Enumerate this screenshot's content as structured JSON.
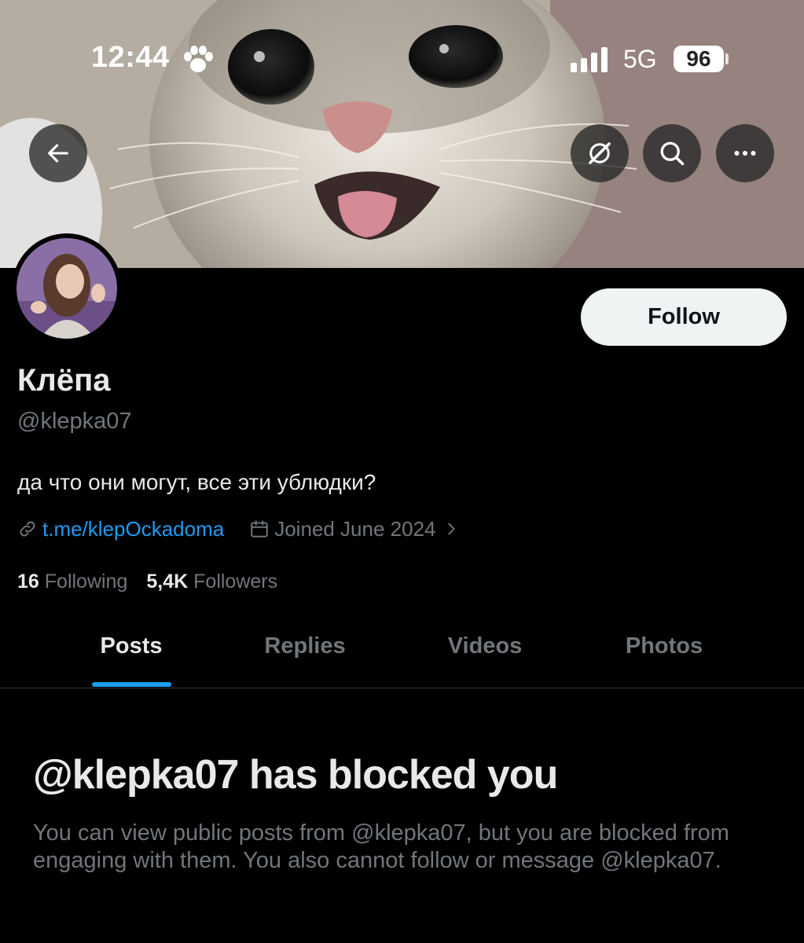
{
  "status_bar": {
    "time": "12:44",
    "network": "5G",
    "battery": "96"
  },
  "header_buttons": {
    "back_icon": "arrow-left-icon",
    "grok_icon": "grok-icon",
    "search_icon": "search-icon",
    "more_icon": "more-icon"
  },
  "profile": {
    "display_name": "Клёпа",
    "handle": "@klepka07",
    "bio": "да что они могут, все эти ублюдки?",
    "link": "t.me/klepOckadoma",
    "joined": "Joined June 2024",
    "following_count": "16",
    "following_label": "Following",
    "followers_count": "5,4K",
    "followers_label": "Followers",
    "follow_label": "Follow"
  },
  "tabs": [
    {
      "label": "Posts",
      "active": true
    },
    {
      "label": "Replies",
      "active": false
    },
    {
      "label": "Videos",
      "active": false
    },
    {
      "label": "Photos",
      "active": false
    }
  ],
  "blocked": {
    "title": "@klepka07 has blocked you",
    "body": "You can view public posts from @klepka07, but you are blocked from engaging with them. You also cannot follow or message @klepka07."
  },
  "colors": {
    "background": "#000000",
    "accent": "#1d9bf0",
    "muted_text": "#71767b",
    "primary_text": "#e7e9ea",
    "follow_button": "#eff3f4"
  }
}
